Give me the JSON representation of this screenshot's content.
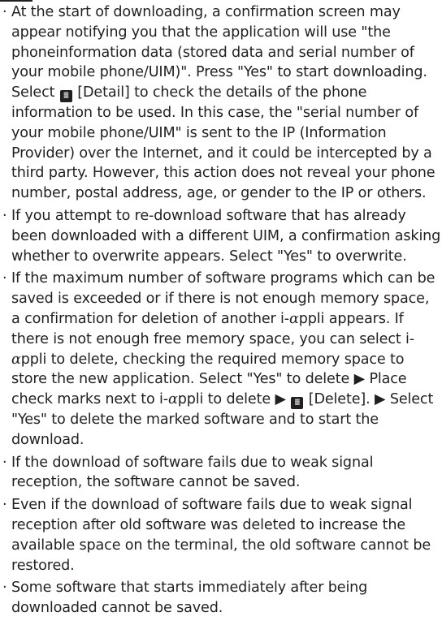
{
  "colors": {
    "text": "#231f20",
    "background": "#ffffff"
  },
  "bullet": "·",
  "icons": {
    "softkey": "menu-softkey-icon",
    "arrow": "right-pointer-icon"
  },
  "notes": [
    {
      "a": "At the start of downloading, a confirmation screen may appear notifying you that the application will use \"the phoneinformation data (stored data and serial number of your mobile phone/UIM)\". Press \"Yes\" to start downloading. Select",
      "b": "[Detail] to check the details of the phone information to be used. In this case, the \"serial number of your mobile phone/UIM\" is sent to the IP (Information Provider) over the Internet, and it could be intercepted by a third party. However, this action does not reveal your phone number, postal address, age, or gender to the IP or others."
    },
    {
      "a": "If you attempt to re-download software that has already been downloaded with a different UIM, a confirmation asking whether to overwrite appears. Select \"Yes\" to overwrite."
    },
    {
      "a": "If the maximum number of software programs which can be saved is exceeded or if there is not enough memory space, a confirmation for deletion of another i-",
      "b": "ppli appears. If there is not enough free memory space, you can select i-",
      "c": "ppli to delete, checking the required memory space to store the new application. Select \"Yes\" to delete",
      "d": "Place check marks next to i-",
      "e": "ppli to delete",
      "f": "[Delete].",
      "g": "Select \"Yes\" to delete the marked software and to start the download."
    },
    {
      "a": "If the download of software fails due to weak signal reception, the software cannot be saved."
    },
    {
      "a": "Even if the download of software fails due to weak signal reception after old software was deleted to increase the available space on the terminal, the old software cannot be restored."
    },
    {
      "a": "Some software that starts immediately after being downloaded cannot be saved."
    }
  ]
}
